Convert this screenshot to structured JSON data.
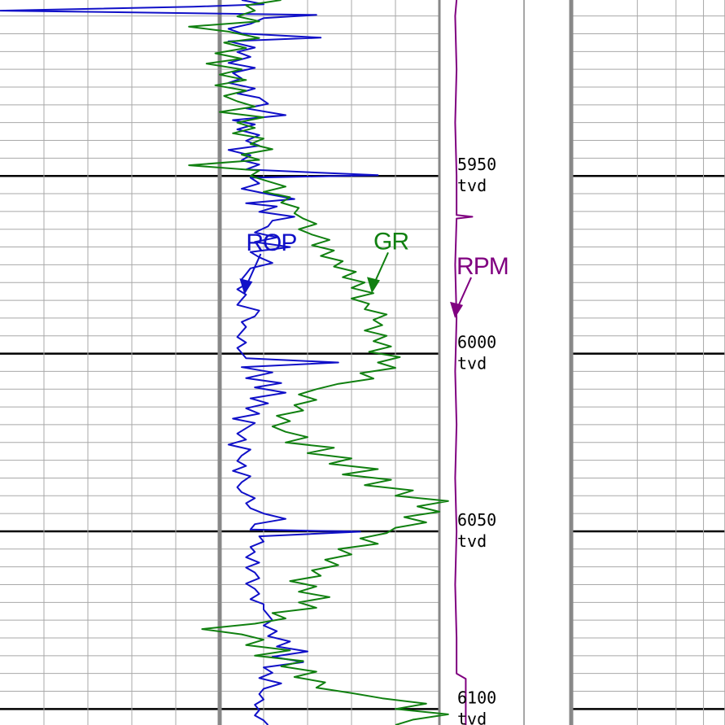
{
  "chart_data": {
    "type": "line",
    "depth_unit": "tvd",
    "depth_range": [
      5900.5,
      6104.5
    ],
    "depth_ticks": [
      {
        "depth": 5950,
        "value": "5950",
        "unit": "tvd"
      },
      {
        "depth": 6000,
        "value": "6000",
        "unit": "tvd"
      },
      {
        "depth": 6050,
        "value": "6050",
        "unit": "tvd"
      },
      {
        "depth": 6100,
        "value": "6100",
        "unit": "tvd"
      }
    ],
    "grid": true,
    "track1_scale": [
      0,
      10
    ],
    "track2_scale": [
      0,
      10
    ],
    "series": [
      {
        "name": "ROP",
        "track": 1,
        "color": "#1010c8",
        "label_depth": 5983,
        "points": [
          [
            5900.5,
            5.5
          ],
          [
            5901.7,
            6.0
          ],
          [
            5902.4,
            4.4
          ],
          [
            5903.5,
            0.0
          ],
          [
            5904.7,
            7.2
          ],
          [
            5905.6,
            6.0
          ],
          [
            5907.2,
            5.7
          ],
          [
            5908.6,
            5.2
          ],
          [
            5909.9,
            5.5
          ],
          [
            5911.1,
            7.3
          ],
          [
            5912.1,
            5.2
          ],
          [
            5913.9,
            5.8
          ],
          [
            5915.1,
            5.4
          ],
          [
            5916.5,
            5.7
          ],
          [
            5918.2,
            5.2
          ],
          [
            5919.6,
            5.8
          ],
          [
            5921.0,
            5.3
          ],
          [
            5922.6,
            5.5
          ],
          [
            5923.8,
            5.2
          ],
          [
            5925.4,
            5.8
          ],
          [
            5926.8,
            5.4
          ],
          [
            5928.0,
            5.9
          ],
          [
            5929.7,
            6.1
          ],
          [
            5931.0,
            5.6
          ],
          [
            5932.9,
            6.5
          ],
          [
            5934.3,
            5.3
          ],
          [
            5935.5,
            5.8
          ],
          [
            5936.9,
            5.4
          ],
          [
            5938.5,
            5.9
          ],
          [
            5940.1,
            5.6
          ],
          [
            5941.5,
            5.9
          ],
          [
            5942.7,
            5.2
          ],
          [
            5944.2,
            5.7
          ],
          [
            5945.6,
            5.5
          ],
          [
            5946.8,
            5.9
          ],
          [
            5948.2,
            5.6
          ],
          [
            5949.8,
            8.6
          ],
          [
            5950.5,
            5.7
          ],
          [
            5952.1,
            5.9
          ],
          [
            5953.6,
            5.5
          ],
          [
            5955.1,
            6.1
          ],
          [
            5956.5,
            6.7
          ],
          [
            5957.7,
            5.6
          ],
          [
            5958.6,
            6.3
          ],
          [
            5960.1,
            5.9
          ],
          [
            5961.5,
            6.7
          ],
          [
            5962.6,
            6.2
          ],
          [
            5964.2,
            6.1
          ],
          [
            5965.9,
            5.8
          ],
          [
            5967.3,
            6.3
          ],
          [
            5968.6,
            5.8
          ],
          [
            5970.0,
            6.6
          ],
          [
            5971.4,
            5.7
          ],
          [
            5972.9,
            5.9
          ],
          [
            5974.5,
            6.2
          ],
          [
            5976.0,
            5.7
          ],
          [
            5977.6,
            5.6
          ],
          [
            5979.1,
            5.5
          ],
          [
            5980.5,
            5.6
          ],
          [
            5981.9,
            5.4
          ],
          [
            5983.4,
            5.6
          ],
          [
            5984.8,
            5.5
          ],
          [
            5986.3,
            5.4
          ],
          [
            5987.9,
            5.9
          ],
          [
            5989.5,
            5.8
          ],
          [
            5991.1,
            5.5
          ],
          [
            5992.5,
            5.6
          ],
          [
            5993.9,
            5.5
          ],
          [
            5995.3,
            5.4
          ],
          [
            5996.9,
            5.6
          ],
          [
            5998.4,
            5.4
          ],
          [
            5999.8,
            5.5
          ],
          [
            6001.3,
            5.6
          ],
          [
            6002.5,
            7.7
          ],
          [
            6003.8,
            5.5
          ],
          [
            6005.3,
            6.2
          ],
          [
            6006.9,
            5.6
          ],
          [
            6008.3,
            6.4
          ],
          [
            6009.5,
            5.8
          ],
          [
            6011.0,
            6.5
          ],
          [
            6012.6,
            5.7
          ],
          [
            6014.0,
            6.1
          ],
          [
            6015.4,
            5.6
          ],
          [
            6016.9,
            5.9
          ],
          [
            6018.3,
            5.3
          ],
          [
            6019.5,
            5.8
          ],
          [
            6021.0,
            5.6
          ],
          [
            6022.5,
            5.4
          ],
          [
            6024.2,
            5.6
          ],
          [
            6025.6,
            5.2
          ],
          [
            6027.0,
            5.7
          ],
          [
            6028.7,
            5.5
          ],
          [
            6030.2,
            5.4
          ],
          [
            6031.6,
            5.6
          ],
          [
            6033.0,
            5.3
          ],
          [
            6034.5,
            5.7
          ],
          [
            6036.2,
            5.5
          ],
          [
            6037.6,
            5.4
          ],
          [
            6039.0,
            5.5
          ],
          [
            6040.7,
            5.8
          ],
          [
            6042.1,
            5.6
          ],
          [
            6043.5,
            5.7
          ],
          [
            6045.0,
            6.0
          ],
          [
            6046.5,
            6.5
          ],
          [
            6048.0,
            5.8
          ],
          [
            6049.5,
            5.7
          ],
          [
            6050.1,
            8.2
          ],
          [
            6051.4,
            5.9
          ],
          [
            6052.9,
            6.0
          ],
          [
            6054.4,
            5.7
          ],
          [
            6055.8,
            5.8
          ],
          [
            6057.3,
            5.6
          ],
          [
            6058.8,
            5.9
          ],
          [
            6060.2,
            5.6
          ],
          [
            6061.6,
            5.8
          ],
          [
            6063.2,
            5.9
          ],
          [
            6064.7,
            5.6
          ],
          [
            6066.2,
            5.8
          ],
          [
            6067.6,
            5.9
          ],
          [
            6069.1,
            5.7
          ],
          [
            6070.5,
            6.0
          ],
          [
            6072.0,
            6.0
          ],
          [
            6073.5,
            6.1
          ],
          [
            6075.0,
            6.2
          ],
          [
            6076.5,
            6.0
          ],
          [
            6078.1,
            6.3
          ],
          [
            6079.5,
            6.1
          ],
          [
            6081.0,
            6.6
          ],
          [
            6082.4,
            6.3
          ],
          [
            6083.8,
            7.0
          ],
          [
            6085.3,
            6.2
          ],
          [
            6086.8,
            6.9
          ],
          [
            6088.3,
            6.0
          ],
          [
            6089.8,
            6.2
          ],
          [
            6091.3,
            5.9
          ],
          [
            6092.8,
            6.4
          ],
          [
            6094.3,
            6.0
          ],
          [
            6095.8,
            5.9
          ],
          [
            6097.3,
            6.0
          ],
          [
            6098.8,
            5.8
          ],
          [
            6100.3,
            5.9
          ],
          [
            6101.8,
            5.8
          ],
          [
            6103.2,
            6.0
          ],
          [
            6104.5,
            6.1
          ]
        ]
      },
      {
        "name": "GR",
        "track": 1,
        "color": "#108010",
        "label_depth": 5983,
        "points": [
          [
            5900.5,
            6.4
          ],
          [
            5902.0,
            5.6
          ],
          [
            5903.5,
            5.8
          ],
          [
            5905.1,
            5.4
          ],
          [
            5906.5,
            5.9
          ],
          [
            5908.0,
            4.3
          ],
          [
            5909.4,
            5.2
          ],
          [
            5911.2,
            5.9
          ],
          [
            5912.5,
            5.1
          ],
          [
            5914.0,
            5.6
          ],
          [
            5915.5,
            4.9
          ],
          [
            5917.0,
            5.5
          ],
          [
            5918.4,
            4.7
          ],
          [
            5920.0,
            5.5
          ],
          [
            5921.5,
            5.0
          ],
          [
            5923.0,
            5.6
          ],
          [
            5924.5,
            4.9
          ],
          [
            5926.0,
            5.6
          ],
          [
            5927.5,
            5.1
          ],
          [
            5929.0,
            5.4
          ],
          [
            5930.5,
            5.8
          ],
          [
            5932.0,
            5.0
          ],
          [
            5933.5,
            6.0
          ],
          [
            5935.0,
            5.4
          ],
          [
            5936.5,
            5.8
          ],
          [
            5938.0,
            5.3
          ],
          [
            5939.5,
            6.0
          ],
          [
            5941.0,
            5.7
          ],
          [
            5942.5,
            6.2
          ],
          [
            5944.0,
            5.5
          ],
          [
            5945.5,
            5.9
          ],
          [
            5947.0,
            4.3
          ],
          [
            5948.5,
            5.9
          ],
          [
            5950.0,
            5.7
          ],
          [
            5951.5,
            6.1
          ],
          [
            5953.0,
            6.5
          ],
          [
            5954.5,
            6.0
          ],
          [
            5956.0,
            6.6
          ],
          [
            5957.5,
            6.4
          ],
          [
            5959.0,
            6.8
          ],
          [
            5960.5,
            6.7
          ],
          [
            5962.0,
            6.9
          ],
          [
            5963.5,
            7.2
          ],
          [
            5965.0,
            6.8
          ],
          [
            5966.5,
            7.1
          ],
          [
            5968.0,
            7.5
          ],
          [
            5969.5,
            7.1
          ],
          [
            5971.0,
            7.6
          ],
          [
            5972.5,
            7.3
          ],
          [
            5974.0,
            7.8
          ],
          [
            5975.5,
            7.6
          ],
          [
            5977.0,
            8.1
          ],
          [
            5978.5,
            7.8
          ],
          [
            5980.0,
            8.3
          ],
          [
            5981.5,
            8.0
          ],
          [
            5983.0,
            8.5
          ],
          [
            5984.5,
            8.0
          ],
          [
            5986.0,
            8.4
          ],
          [
            5987.5,
            8.3
          ],
          [
            5989.0,
            8.8
          ],
          [
            5990.5,
            8.5
          ],
          [
            5992.0,
            8.7
          ],
          [
            5993.5,
            8.3
          ],
          [
            5995.0,
            8.8
          ],
          [
            5996.5,
            8.5
          ],
          [
            5998.0,
            8.9
          ],
          [
            5999.5,
            8.4
          ],
          [
            6001.0,
            9.1
          ],
          [
            6002.5,
            8.6
          ],
          [
            6004.0,
            9.0
          ],
          [
            6005.5,
            8.2
          ],
          [
            6007.0,
            8.5
          ],
          [
            6008.5,
            7.7
          ],
          [
            6010.0,
            7.2
          ],
          [
            6011.5,
            6.8
          ],
          [
            6013.0,
            7.2
          ],
          [
            6014.5,
            6.7
          ],
          [
            6016.0,
            6.9
          ],
          [
            6017.5,
            6.3
          ],
          [
            6019.0,
            6.6
          ],
          [
            6020.5,
            6.2
          ],
          [
            6022.0,
            6.5
          ],
          [
            6023.5,
            7.0
          ],
          [
            6025.0,
            6.5
          ],
          [
            6026.5,
            7.6
          ],
          [
            6028.0,
            7.0
          ],
          [
            6029.5,
            8.0
          ],
          [
            6031.0,
            7.5
          ],
          [
            6032.5,
            8.6
          ],
          [
            6034.0,
            7.8
          ],
          [
            6035.5,
            8.9
          ],
          [
            6037.0,
            8.3
          ],
          [
            6038.5,
            9.4
          ],
          [
            6040.0,
            9.0
          ],
          [
            6041.5,
            10.2
          ],
          [
            6043.0,
            9.5
          ],
          [
            6044.5,
            10.0
          ],
          [
            6046.0,
            9.2
          ],
          [
            6047.5,
            9.7
          ],
          [
            6049.0,
            9.0
          ],
          [
            6050.5,
            8.8
          ],
          [
            6052.0,
            8.2
          ],
          [
            6053.5,
            8.6
          ],
          [
            6055.0,
            7.7
          ],
          [
            6056.5,
            8.0
          ],
          [
            6058.0,
            7.4
          ],
          [
            6059.5,
            7.7
          ],
          [
            6061.0,
            7.1
          ],
          [
            6062.5,
            7.3
          ],
          [
            6064.0,
            6.6
          ],
          [
            6065.5,
            7.2
          ],
          [
            6067.0,
            6.8
          ],
          [
            6068.5,
            7.5
          ],
          [
            6070.0,
            6.8
          ],
          [
            6071.5,
            7.2
          ],
          [
            6073.0,
            6.2
          ],
          [
            6074.5,
            6.5
          ],
          [
            6076.0,
            5.8
          ],
          [
            6077.5,
            4.6
          ],
          [
            6079.0,
            5.5
          ],
          [
            6080.5,
            6.0
          ],
          [
            6082.0,
            5.6
          ],
          [
            6083.5,
            6.6
          ],
          [
            6085.0,
            5.8
          ],
          [
            6086.5,
            6.9
          ],
          [
            6088.0,
            6.4
          ],
          [
            6089.5,
            7.2
          ],
          [
            6091.0,
            6.7
          ],
          [
            6092.5,
            7.4
          ],
          [
            6094.0,
            7.2
          ],
          [
            6095.5,
            8.0
          ],
          [
            6097.0,
            8.7
          ],
          [
            6098.5,
            9.7
          ],
          [
            6100.0,
            9.0
          ],
          [
            6101.5,
            10.2
          ],
          [
            6103.0,
            9.4
          ],
          [
            6104.5,
            9.0
          ]
        ]
      },
      {
        "name": "RPM",
        "track": 2,
        "color": "#800080",
        "label_depth": 5983,
        "points": [
          [
            5900.5,
            1.3
          ],
          [
            5905.0,
            1.2
          ],
          [
            5920.0,
            1.3
          ],
          [
            5935.0,
            1.2
          ],
          [
            5950.0,
            1.3
          ],
          [
            5961.0,
            1.3
          ],
          [
            5961.5,
            2.5
          ],
          [
            5962.0,
            1.3
          ],
          [
            5975.0,
            1.2
          ],
          [
            5990.0,
            1.3
          ],
          [
            6005.0,
            1.2
          ],
          [
            6020.0,
            1.3
          ],
          [
            6035.0,
            1.2
          ],
          [
            6050.0,
            1.3
          ],
          [
            6065.0,
            1.2
          ],
          [
            6080.0,
            1.3
          ],
          [
            6090.0,
            1.3
          ],
          [
            6091.5,
            2.0
          ],
          [
            6104.5,
            2.0
          ]
        ]
      }
    ]
  }
}
